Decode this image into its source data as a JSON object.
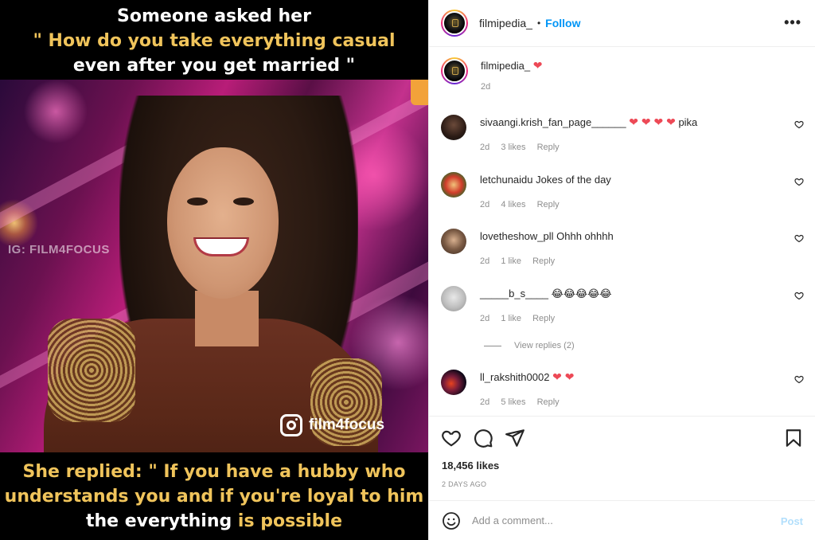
{
  "meme": {
    "top_line_1": "Someone asked her",
    "top_line_2": "\" How do you take everything casual",
    "top_line_3": "even after you get married \"",
    "watermark_ig": "IG: FILM4FOCUS",
    "watermark_handle": "film4focus",
    "bottom_1a": "She replied: \" If you have ",
    "bottom_1b": "a hubby who",
    "bottom_2": "understands you and if you're loyal to him",
    "bottom_3a": "the everything ",
    "bottom_3b": "is possible"
  },
  "header": {
    "username": "filmipedia_",
    "dot": "•",
    "follow_label": "Follow",
    "more_label": "•••"
  },
  "caption": {
    "username": "filmipedia_",
    "text": "❤",
    "time": "2d"
  },
  "comments": [
    {
      "username": "sivaangi.krish_fan_page______",
      "hearts": "❤ ❤ ❤ ❤",
      "text": "pika",
      "time": "2d",
      "likes": "3 likes",
      "reply": "Reply"
    },
    {
      "username": "letchunaidu",
      "text": "Jokes of the day",
      "time": "2d",
      "likes": "4 likes",
      "reply": "Reply"
    },
    {
      "username": "lovetheshow_pll",
      "text": "Ohhh ohhhh",
      "time": "2d",
      "likes": "1 like",
      "reply": "Reply"
    },
    {
      "username": "_____b_s____",
      "text": "😂😂😂😂😂",
      "time": "2d",
      "likes": "1 like",
      "reply": "Reply"
    },
    {
      "username": "ll_rakshith0002",
      "hearts": "❤ ❤",
      "text": "",
      "time": "2d",
      "likes": "5 likes",
      "reply": "Reply"
    }
  ],
  "view_replies": "View replies (2)",
  "likes": "18,456 likes",
  "date": "2 DAYS AGO",
  "comment_box": {
    "placeholder": "Add a comment...",
    "post_label": "Post"
  },
  "icons": {
    "like": "heart-outline-icon",
    "comment": "speech-bubble-icon",
    "share": "paper-plane-icon",
    "save": "bookmark-icon",
    "emoji": "smiley-icon",
    "more": "more-options-icon"
  },
  "colors": {
    "follow_blue": "#0095f6",
    "post_disabled": "#b2dffc",
    "heart_red": "#ed4956",
    "meme_gold": "#f0c45b"
  }
}
